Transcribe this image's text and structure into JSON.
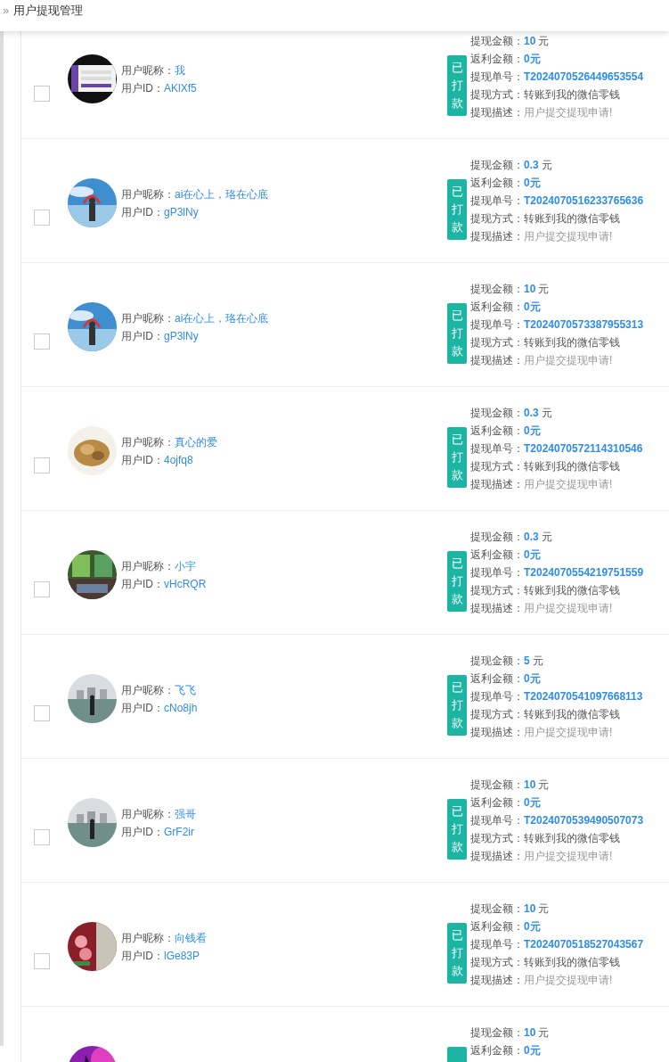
{
  "header": {
    "icon": "»",
    "title": "用户提现管理"
  },
  "records": [
    {
      "checked": false,
      "nickname": {
        "label": "用户昵称：",
        "value": "我"
      },
      "user_id": {
        "label": "用户ID：",
        "value": "AKlXf5"
      },
      "status": "已打款",
      "amount": {
        "label": "提现金额：",
        "value": "10",
        "unit": "元"
      },
      "rebate": {
        "label": "返利金额：",
        "value": "0元"
      },
      "order_no": {
        "label": "提现单号：",
        "value": "T2024070526449653554"
      },
      "method": {
        "label": "提现方式：",
        "value": "转账到我的微信零钱"
      },
      "description": {
        "label": "提现描述：",
        "value": "用户提交提现申请!"
      }
    },
    {
      "checked": false,
      "nickname": {
        "label": "用户昵称：",
        "value": "ai在心上，珞在心底"
      },
      "user_id": {
        "label": "用户ID：",
        "value": "gP3lNy"
      },
      "status": "已打款",
      "amount": {
        "label": "提现金额：",
        "value": "0.3",
        "unit": "元"
      },
      "rebate": {
        "label": "返利金额：",
        "value": "0元"
      },
      "order_no": {
        "label": "提现单号：",
        "value": "T2024070516233765636"
      },
      "method": {
        "label": "提现方式：",
        "value": "转账到我的微信零钱"
      },
      "description": {
        "label": "提现描述：",
        "value": "用户提交提现申请!"
      }
    },
    {
      "checked": false,
      "nickname": {
        "label": "用户昵称：",
        "value": "ai在心上，珞在心底"
      },
      "user_id": {
        "label": "用户ID：",
        "value": "gP3lNy"
      },
      "status": "已打款",
      "amount": {
        "label": "提现金额：",
        "value": "10",
        "unit": "元"
      },
      "rebate": {
        "label": "返利金额：",
        "value": "0元"
      },
      "order_no": {
        "label": "提现单号：",
        "value": "T2024070573387955313"
      },
      "method": {
        "label": "提现方式：",
        "value": "转账到我的微信零钱"
      },
      "description": {
        "label": "提现描述：",
        "value": "用户提交提现申请!"
      }
    },
    {
      "checked": false,
      "nickname": {
        "label": "用户昵称：",
        "value": "真心的爱"
      },
      "user_id": {
        "label": "用户ID：",
        "value": "4ojfq8"
      },
      "status": "已打款",
      "amount": {
        "label": "提现金额：",
        "value": "0.3",
        "unit": "元"
      },
      "rebate": {
        "label": "返利金额：",
        "value": "0元"
      },
      "order_no": {
        "label": "提现单号：",
        "value": "T2024070572114310546"
      },
      "method": {
        "label": "提现方式：",
        "value": "转账到我的微信零钱"
      },
      "description": {
        "label": "提现描述：",
        "value": "用户提交提现申请!"
      }
    },
    {
      "checked": false,
      "nickname": {
        "label": "用户昵称：",
        "value": "小宇"
      },
      "user_id": {
        "label": "用户ID：",
        "value": "vHcRQR"
      },
      "status": "已打款",
      "amount": {
        "label": "提现金额：",
        "value": "0.3",
        "unit": "元"
      },
      "rebate": {
        "label": "返利金额：",
        "value": "0元"
      },
      "order_no": {
        "label": "提现单号：",
        "value": "T2024070554219751559"
      },
      "method": {
        "label": "提现方式：",
        "value": "转账到我的微信零钱"
      },
      "description": {
        "label": "提现描述：",
        "value": "用户提交提现申请!"
      }
    },
    {
      "checked": false,
      "nickname": {
        "label": "用户昵称：",
        "value": "飞飞"
      },
      "user_id": {
        "label": "用户ID：",
        "value": "cNo8jh"
      },
      "status": "已打款",
      "amount": {
        "label": "提现金额：",
        "value": "5",
        "unit": "元"
      },
      "rebate": {
        "label": "返利金额：",
        "value": "0元"
      },
      "order_no": {
        "label": "提现单号：",
        "value": "T2024070541097668113"
      },
      "method": {
        "label": "提现方式：",
        "value": "转账到我的微信零钱"
      },
      "description": {
        "label": "提现描述：",
        "value": "用户提交提现申请!"
      }
    },
    {
      "checked": false,
      "nickname": {
        "label": "用户昵称：",
        "value": "强哥"
      },
      "user_id": {
        "label": "用户ID：",
        "value": "GrF2ir"
      },
      "status": "已打款",
      "amount": {
        "label": "提现金额：",
        "value": "10",
        "unit": "元"
      },
      "rebate": {
        "label": "返利金额：",
        "value": "0元"
      },
      "order_no": {
        "label": "提现单号：",
        "value": "T2024070539490507073"
      },
      "method": {
        "label": "提现方式：",
        "value": "转账到我的微信零钱"
      },
      "description": {
        "label": "提现描述：",
        "value": "用户提交提现申请!"
      }
    },
    {
      "checked": false,
      "nickname": {
        "label": "用户昵称：",
        "value": "向钱看"
      },
      "user_id": {
        "label": "用户ID：",
        "value": "lGe83P"
      },
      "status": "已打款",
      "amount": {
        "label": "提现金额：",
        "value": "10",
        "unit": "元"
      },
      "rebate": {
        "label": "返利金额：",
        "value": "0元"
      },
      "order_no": {
        "label": "提现单号：",
        "value": "T2024070518527043567"
      },
      "method": {
        "label": "提现方式：",
        "value": "转账到我的微信零钱"
      },
      "description": {
        "label": "提现描述：",
        "value": "用户提交提现申请!"
      }
    },
    {
      "amount": {
        "label": "提现金额：",
        "value": "10",
        "unit": "元"
      },
      "rebate": {
        "label": "返利金额：",
        "value": "0元"
      }
    }
  ]
}
